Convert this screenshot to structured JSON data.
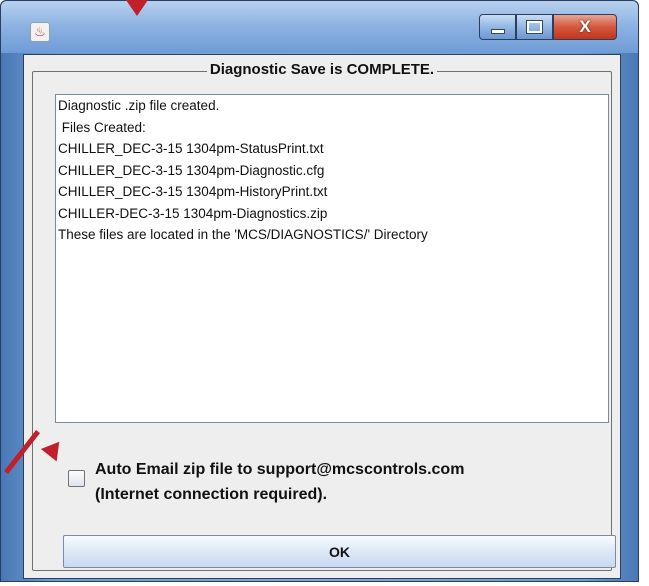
{
  "window": {
    "title": "",
    "icon": "java-cup-icon",
    "minimize_glyph": "minimize-icon",
    "maximize_glyph": "maximize-icon",
    "close_label": "X"
  },
  "dialog": {
    "group_title": "Diagnostic Save is COMPLETE.",
    "lines": [
      "Diagnostic .zip file created.",
      " Files Created:",
      "CHILLER_DEC-3-15 1304pm-StatusPrint.txt",
      "CHILLER_DEC-3-15 1304pm-Diagnostic.cfg",
      "CHILLER_DEC-3-15 1304pm-HistoryPrint.txt",
      "CHILLER-DEC-3-15 1304pm-Diagnostics.zip",
      "These files are located in the 'MCS/DIAGNOSTICS/' Directory"
    ],
    "checkbox_label_line1": "Auto Email zip file to support@mcscontrols.com",
    "checkbox_label_line2": "(Internet connection required).",
    "checkbox_checked": false,
    "ok_label": "OK"
  },
  "annotations": {
    "arrow_color": "#c0202a"
  }
}
